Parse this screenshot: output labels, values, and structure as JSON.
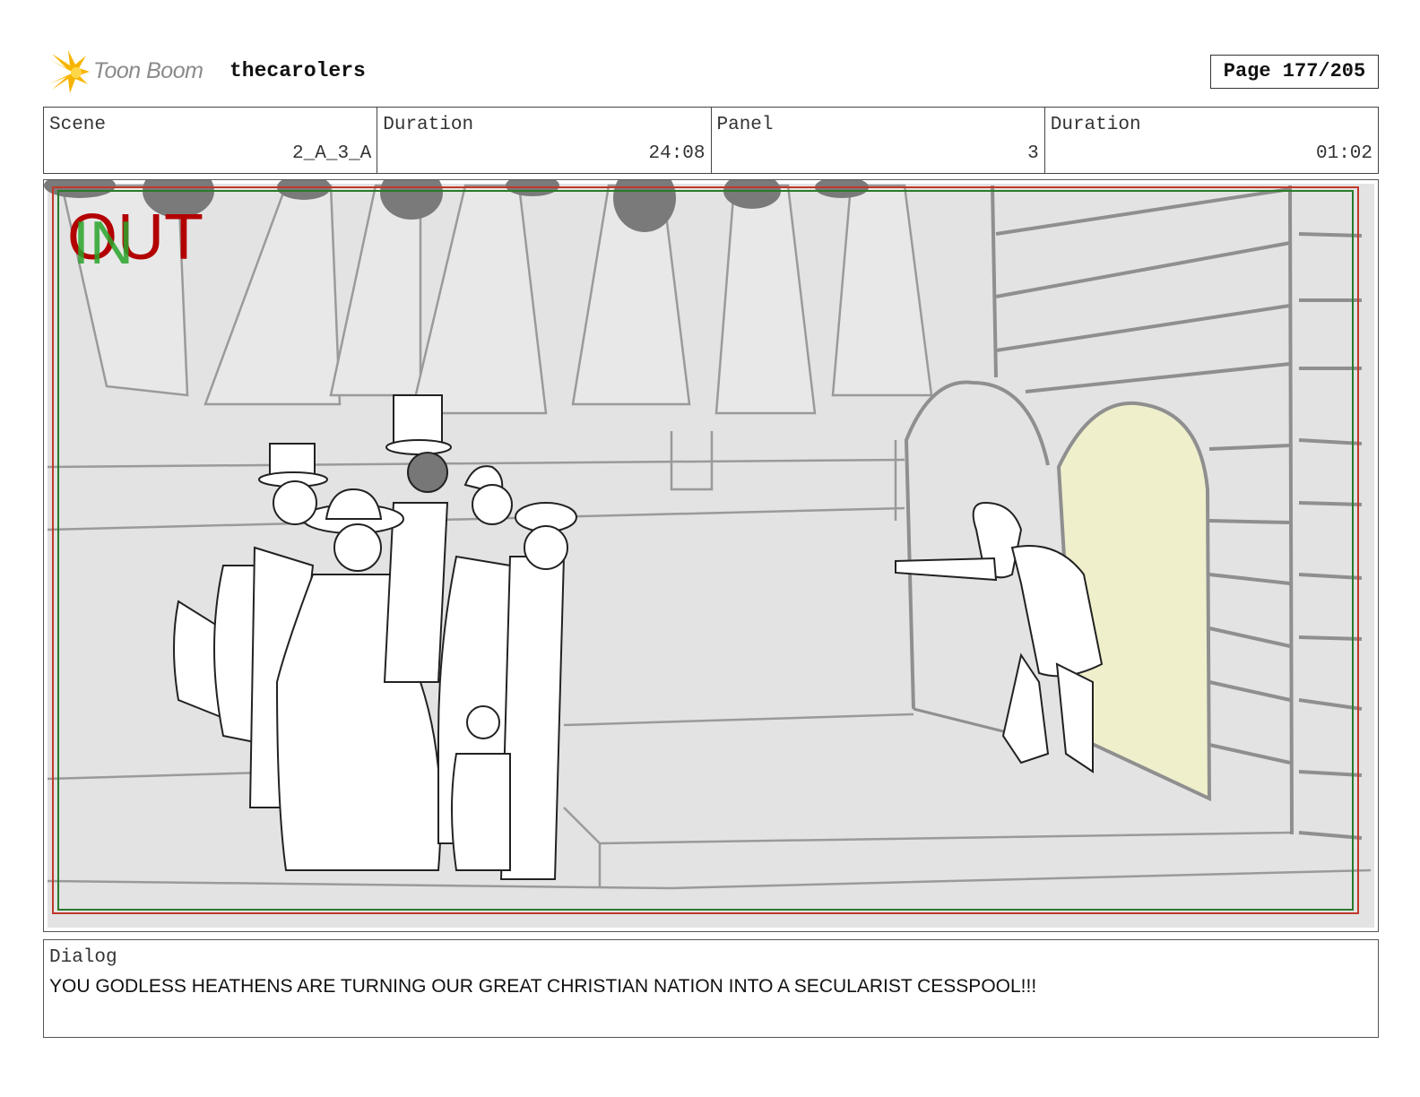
{
  "header": {
    "logo_text": "Toon Boom",
    "project": "thecarolers",
    "page": "Page 177/205"
  },
  "info": {
    "scene_label": "Scene",
    "scene_value": "2_A_3_A",
    "scene_duration_label": "Duration",
    "scene_duration_value": "24:08",
    "panel_label": "Panel",
    "panel_value": "3",
    "panel_duration_label": "Duration",
    "panel_duration_value": "01:02"
  },
  "panel": {
    "in_mark": "IN",
    "out_mark": "OUT"
  },
  "dialog": {
    "label": "Dialog",
    "text": "YOU GODLESS HEATHENS ARE TURNING OUR GREAT CHRISTIAN NATION INTO A SECULARIST CESSPOOL!!!"
  },
  "colors": {
    "out_red": "#b30000",
    "in_green": "#2aa52a",
    "door_yellow": "#efefcc"
  }
}
